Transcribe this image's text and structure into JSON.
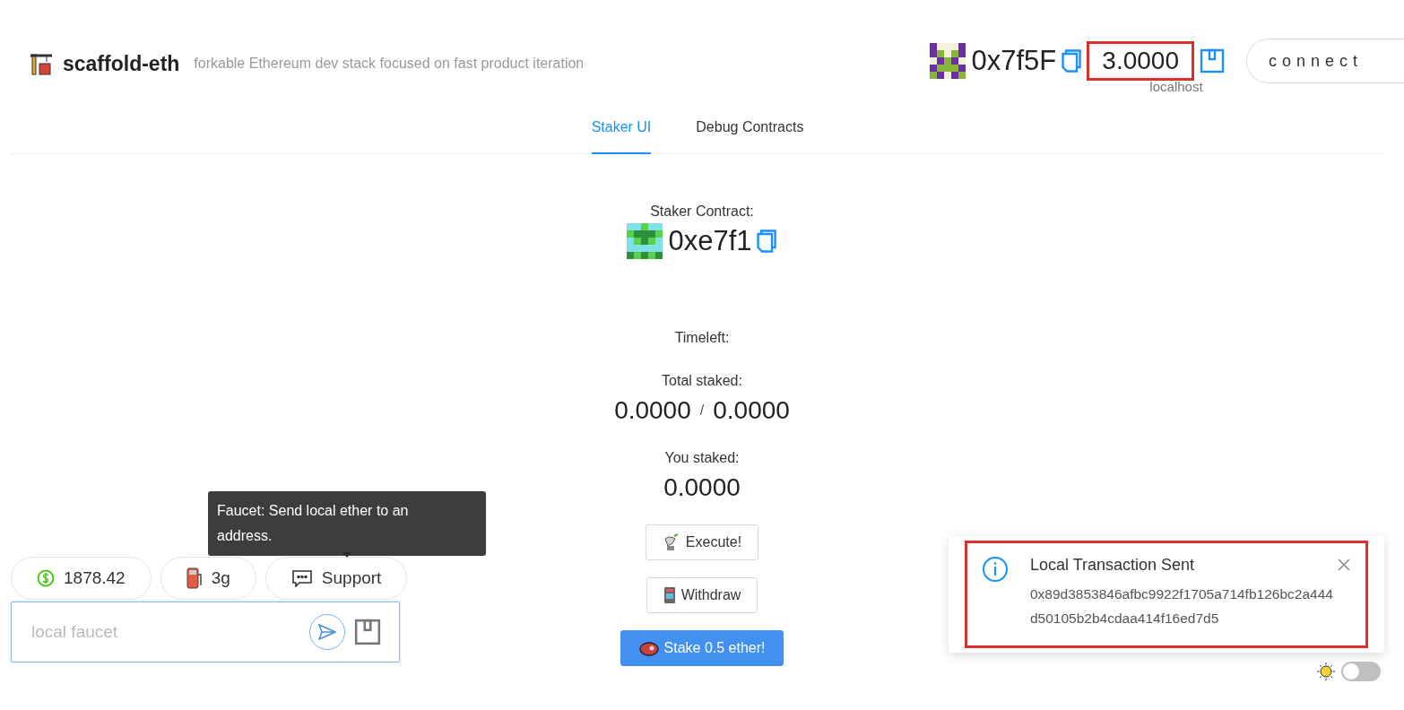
{
  "header": {
    "title": "scaffold-eth",
    "subtitle": "forkable Ethereum dev stack focused on fast product iteration",
    "account": {
      "address": "0x7f5F",
      "balance": "3.0000",
      "balance_highlighted": true,
      "network": "localhost"
    },
    "connect_button": "connect"
  },
  "tabs": [
    {
      "label": "Staker UI",
      "selected": true
    },
    {
      "label": "Debug Contracts",
      "selected": false
    }
  ],
  "staker": {
    "contract_label": "Staker Contract:",
    "contract_address": "0xe7f1",
    "timeleft_label": "Timeleft:",
    "total_staked_label": "Total staked:",
    "total_staked": "0.0000",
    "separator": "/",
    "threshold": "0.0000",
    "you_staked_label": "You staked:",
    "you_staked": "0.0000"
  },
  "actions": [
    {
      "label": "Execute!",
      "kind": "execute"
    },
    {
      "label": "Withdraw",
      "kind": "withdraw"
    },
    {
      "label": "Stake 0.5 ether!",
      "kind": "stake"
    }
  ],
  "pills": [
    {
      "kind": "price",
      "text": "1878.42"
    },
    {
      "kind": "gas",
      "text": "3g"
    },
    {
      "kind": "support",
      "text": "Support"
    }
  ],
  "faucet": {
    "placeholder": "local faucet"
  },
  "tooltip": "Faucet: Send local ether to an address.",
  "notification": {
    "title": "Local Transaction Sent",
    "message": "0x89d3853846afbc9922f1705a714fb126bc2a444d50105b2b4cdaa414f16ed7d5",
    "highlighted": true
  },
  "theme_toggle": {
    "on": false
  }
}
